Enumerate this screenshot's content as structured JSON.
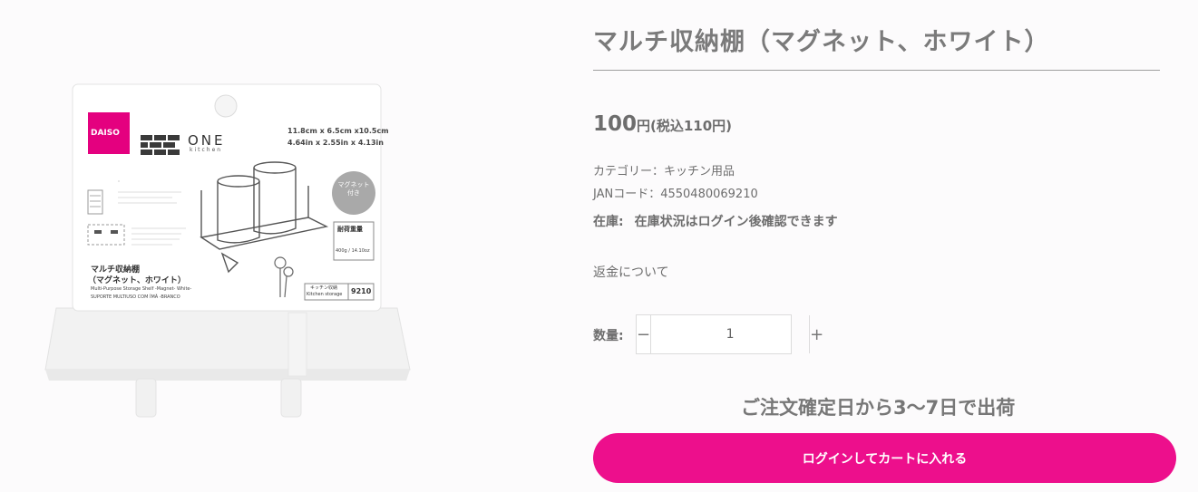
{
  "product": {
    "title": "マルチ収納棚（マグネット、ホワイト）",
    "price_value": "100",
    "price_unit": "円(税込110円)",
    "category": "カテゴリー：キッチン用品",
    "jan": "JANコード：4550480069210",
    "stock_label": "在庫:",
    "stock_status": "在庫状況はログイン後確認できます",
    "refund_link": "返金について",
    "quantity_label": "数量:",
    "quantity_value": "1",
    "minus_symbol": "−",
    "plus_symbol": "+",
    "shipping_note": "ご注文確定日から3〜7日で出荷",
    "cart_button": "ログインしてカートに入れる"
  },
  "package": {
    "brand_logo": "DAISO",
    "line_name": "ONE",
    "line_sub": "kitchen",
    "dimensions_cm": "11.8cm x 6.5cm x10.5cm",
    "dimensions_in": "4.64in x 2.55in x 4.13in",
    "magnet_badge": "マグネット付き",
    "load_label": "耐荷重量",
    "load_value": "400g / 14.10oz",
    "name_jp_line1": "マルチ収納棚",
    "name_jp_line2": "（マグネット、ホワイト）",
    "name_en": "Multi-Purpose Storage Shelf -Magnet- White-",
    "name_pt": "SUPORTE MULTIUSO COM ÍMÃ -BRANCO",
    "category_jp": "キッチン収納",
    "category_en": "Kitchen storage",
    "item_code": "9210"
  },
  "colors": {
    "accent": "#ed0f8c",
    "daiso_logo": "#e4007f"
  }
}
